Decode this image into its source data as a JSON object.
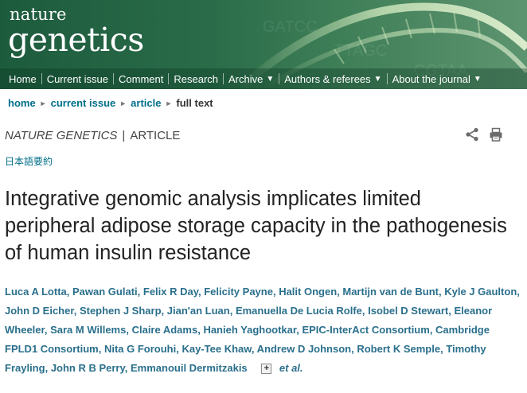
{
  "logo": {
    "top": "nature",
    "main": "genetics"
  },
  "nav": {
    "items": [
      {
        "label": "Home",
        "dropdown": false
      },
      {
        "label": "Current issue",
        "dropdown": false
      },
      {
        "label": "Comment",
        "dropdown": false
      },
      {
        "label": "Research",
        "dropdown": false
      },
      {
        "label": "Archive",
        "dropdown": true
      },
      {
        "label": "Authors & referees",
        "dropdown": true
      },
      {
        "label": "About the journal",
        "dropdown": true
      }
    ],
    "caret": "▼"
  },
  "breadcrumb": {
    "home": "home",
    "current_issue": "current issue",
    "article": "article",
    "current": "full text",
    "arrow": "►"
  },
  "article_type": {
    "journal": "NATURE GENETICS",
    "pipe": "|",
    "type": "ARTICLE"
  },
  "japanese_summary": "日本語要約",
  "title": "Integrative genomic analysis implicates limited peripheral adipose storage capacity in the pathogenesis of human insulin resistance",
  "authors": [
    "Luca A Lotta",
    "Pawan Gulati",
    "Felix R Day",
    "Felicity Payne",
    "Halit Ongen",
    "Martijn van de Bunt",
    "Kyle J Gaulton",
    "John D Eicher",
    "Stephen J Sharp",
    "Jian'an Luan",
    "Emanuella De Lucia Rolfe",
    "Isobel D Stewart",
    "Eleanor Wheeler",
    "Sara M Willems",
    "Claire Adams",
    "Hanieh Yaghootkar",
    "EPIC-InterAct Consortium",
    "Cambridge FPLD1 Consortium",
    "Nita G Forouhi",
    "Kay-Tee Khaw",
    "Andrew D Johnson",
    "Robert K Semple",
    "Timothy Frayling",
    "John R B Perry",
    "Emmanouil Dermitzakis"
  ],
  "authors_expand": "+",
  "et_al": "et al.",
  "colors": {
    "masthead": "#2a6c49",
    "link": "#006f8a",
    "author": "#2a6f8c"
  }
}
